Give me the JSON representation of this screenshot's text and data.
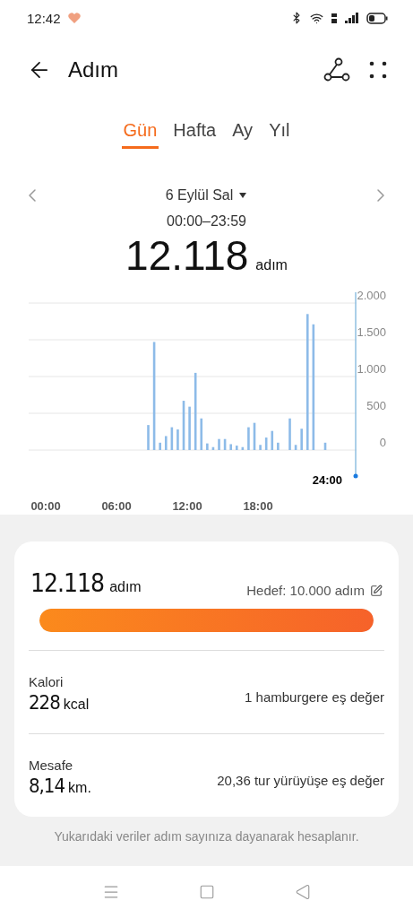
{
  "status_bar": {
    "time": "12:42"
  },
  "header": {
    "title": "Adım"
  },
  "tabs": [
    {
      "label": "Gün",
      "selected": true
    },
    {
      "label": "Hafta",
      "selected": false
    },
    {
      "label": "Ay",
      "selected": false
    },
    {
      "label": "Yıl",
      "selected": false
    }
  ],
  "date_picker": {
    "date": "6 Eylül Sal",
    "range": "00:00–23:59"
  },
  "total": {
    "value": "12.118",
    "unit": "adım"
  },
  "chart": {
    "cursor_label": "24:00",
    "chart_data": {
      "type": "bar",
      "grid": true,
      "x": [
        8.5,
        9,
        9.5,
        10,
        10.5,
        11,
        11.5,
        12,
        12.5,
        13,
        13.5,
        14,
        14.5,
        15,
        15.5,
        16,
        16.5,
        17,
        17.5,
        18,
        18.5,
        19,
        19.5,
        20.5,
        21,
        21.5,
        22,
        22.5,
        23.5
      ],
      "series": [
        {
          "color": "#8dbbe8",
          "values": [
            340,
            1470,
            100,
            190,
            310,
            280,
            670,
            590,
            1050,
            430,
            90,
            40,
            150,
            150,
            80,
            60,
            40,
            310,
            370,
            70,
            170,
            260,
            100,
            430,
            70,
            290,
            1850,
            1710,
            100
          ]
        }
      ],
      "xlim": [
        0,
        24
      ],
      "ylim": [
        0,
        2000
      ],
      "yticks": [
        {
          "value": 0,
          "label": "0"
        },
        {
          "value": 500,
          "label": "500"
        },
        {
          "value": 1000,
          "label": "1.000"
        },
        {
          "value": 1500,
          "label": "1.500"
        },
        {
          "value": 2000,
          "label": "2.000"
        }
      ],
      "xticks": [
        {
          "value": 0,
          "label": "00:00"
        },
        {
          "value": 6,
          "label": "06:00"
        },
        {
          "value": 12,
          "label": "12:00"
        },
        {
          "value": 18,
          "label": "18:00"
        }
      ]
    }
  },
  "summary": {
    "value": "12.118",
    "unit": "adım",
    "goal": "Hedef: 10.000 adım",
    "level": 1
  },
  "stats": [
    {
      "label": "Kalori",
      "value": "228",
      "unit": "kcal",
      "note": "1 hamburgere eş değer"
    },
    {
      "label": "Mesafe",
      "value": "8,14",
      "unit": "km.",
      "note": "20,36 tur yürüyüşe eş değer"
    }
  ],
  "footer": "Yukarıdaki veriler adım sayınıza dayanarak hesaplanır."
}
